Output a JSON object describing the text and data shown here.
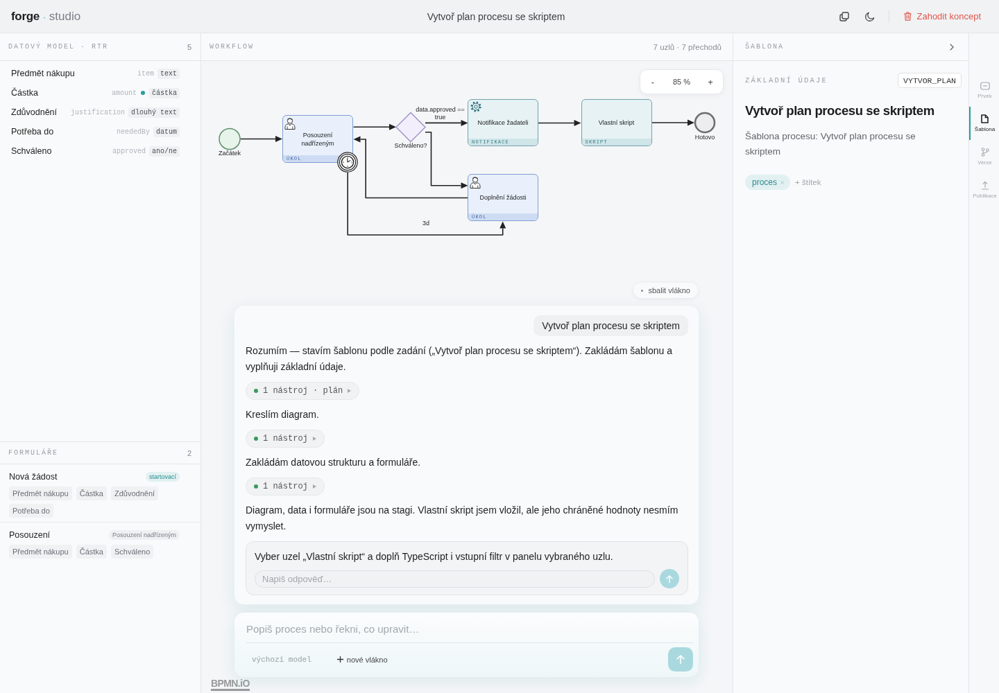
{
  "topbar": {
    "logo": {
      "name": "forge",
      "separator": "·",
      "product": "studio"
    },
    "title": "Vytvoř plan procesu se skriptem",
    "discard": "Zahodit koncept"
  },
  "data_model": {
    "title": "DATOVÝ MODEL · RTR",
    "count": "5",
    "fields": [
      {
        "label": "Předmět nákupu",
        "key": "item",
        "type": "text",
        "flagged": false
      },
      {
        "label": "Částka",
        "key": "amount",
        "type": "částka",
        "flagged": true
      },
      {
        "label": "Zdůvodnění",
        "key": "justification",
        "type": "dlouhý text",
        "flagged": false
      },
      {
        "label": "Potřeba do",
        "key": "neededBy",
        "type": "datum",
        "flagged": false
      },
      {
        "label": "Schváleno",
        "key": "approved",
        "type": "ano/ne",
        "flagged": false
      }
    ]
  },
  "forms": {
    "title": "FORMULÁŘE",
    "count": "2",
    "items": [
      {
        "name": "Nová žádost",
        "badge": "startovací",
        "kind": "start",
        "fields": [
          "Předmět nákupu",
          "Částka",
          "Zdůvodnění",
          "Potřeba do"
        ]
      },
      {
        "name": "Posouzení",
        "badge": "Posouzení nadřízeným",
        "kind": "task",
        "fields": [
          "Předmět nákupu",
          "Částka",
          "Schváleno"
        ]
      }
    ]
  },
  "workflow": {
    "title": "WORKFLOW",
    "stats": "7 uzlů · 7 přechodů",
    "zoom": {
      "out": "-",
      "value": "85 %",
      "in": "+"
    },
    "nodes": [
      {
        "kind": "start",
        "label": "Začátek"
      },
      {
        "kind": "user_task",
        "label": "Posouzení nadřízeným",
        "type": "ÚKOL"
      },
      {
        "kind": "gateway",
        "label": "Schváleno?"
      },
      {
        "kind": "service_task",
        "label": "Notifikace žadateli",
        "type": "NOTIFIKACE"
      },
      {
        "kind": "script_task",
        "label": "Vlastní skript",
        "type": "SKRIPT"
      },
      {
        "kind": "end",
        "label": "Hotovo"
      },
      {
        "kind": "user_task",
        "label": "Doplnění žádosti",
        "type": "ÚKOL"
      }
    ],
    "flow_labels": [
      "data.approved == true",
      "3d"
    ],
    "logo": "BPMN.iO"
  },
  "chat": {
    "collapse": "sbalit vlákno",
    "messages": [
      {
        "kind": "user",
        "text": "Vytvoř plan procesu se skriptem"
      },
      {
        "kind": "assistant",
        "text": "Rozumím — stavím šablonu podle zadání („Vytvoř plan procesu se skriptem“). Zakládám šablonu a vyplňuji základní údaje."
      },
      {
        "kind": "tool",
        "text": "1 nástroj · plán"
      },
      {
        "kind": "assistant",
        "text": "Kreslím diagram."
      },
      {
        "kind": "tool",
        "text": "1 nástroj"
      },
      {
        "kind": "assistant",
        "text": "Zakládám datovou strukturu a formuláře."
      },
      {
        "kind": "tool",
        "text": "1 nástroj"
      },
      {
        "kind": "assistant",
        "text": "Diagram, data i formuláře jsou na stagi. Vlastní skript jsem vložil, ale jeho chráněné hodnoty nesmím vymyslet."
      },
      {
        "kind": "question",
        "text": "Vyber uzel „Vlastní skript“ a doplň TypeScript i vstupní filtr v panelu vybraného uzlu.",
        "placeholder": "Napiš odpověď…"
      }
    ]
  },
  "composer": {
    "placeholder": "Popiš proces nebo řekni, co upravit…",
    "model": "výchozí model",
    "new_thread": "nové vlákno"
  },
  "template_panel": {
    "title": "ŠABLONA",
    "section": "ZÁKLADNÍ ÚDAJE",
    "code": "VYTVOR_PLAN",
    "name": "Vytvoř plan procesu se skriptem",
    "description": "Šablona procesu: Vytvoř plan procesu se skriptem",
    "tags": [
      {
        "label": "proces"
      }
    ],
    "add_tag": "+ štítek"
  },
  "rail": [
    {
      "label": "Prvek",
      "selected": false
    },
    {
      "label": "Šablona",
      "selected": true
    },
    {
      "label": "Verze",
      "selected": false
    },
    {
      "label": "Publikace",
      "selected": false
    }
  ]
}
